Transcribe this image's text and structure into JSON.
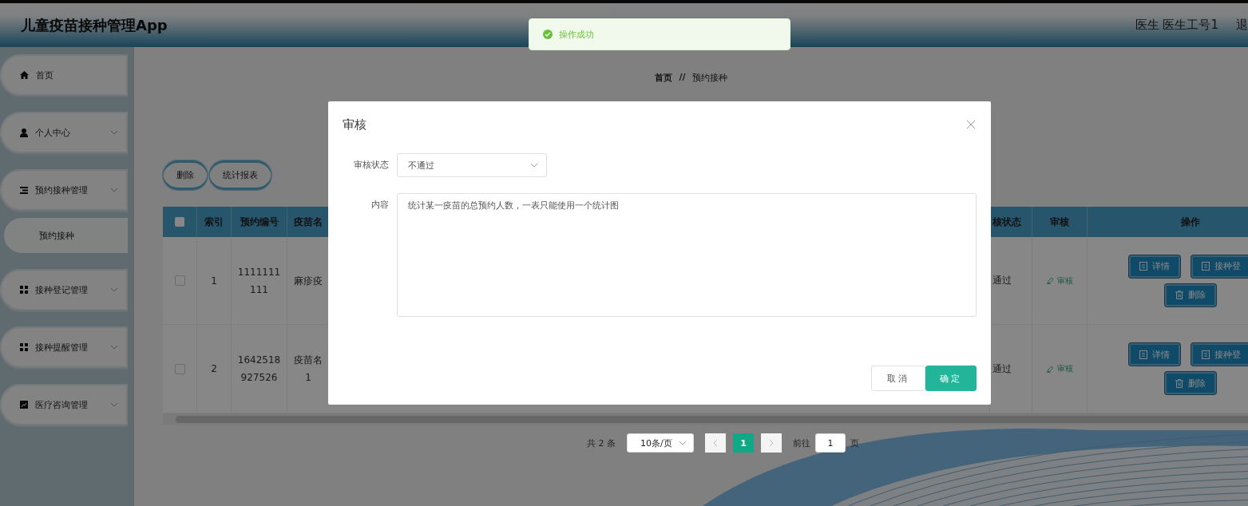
{
  "app": {
    "title": "儿童疫苗接种管理App",
    "user": "医生 医生工号1",
    "logout": "退"
  },
  "toast": {
    "kind": "success",
    "message": "操作成功"
  },
  "sidebar": {
    "items": [
      {
        "label": "首页",
        "kind": "home",
        "dropdown": false
      },
      {
        "label": "个人中心",
        "kind": "user",
        "dropdown": true
      },
      {
        "label": "预约接种管理",
        "kind": "list",
        "dropdown": true,
        "children": [
          {
            "label": "预约接种"
          }
        ]
      },
      {
        "label": "接种登记管理",
        "kind": "grid",
        "dropdown": true
      },
      {
        "label": "接种提醒管理",
        "kind": "grid",
        "dropdown": true
      },
      {
        "label": "医疗咨询管理",
        "kind": "chart",
        "dropdown": true
      }
    ]
  },
  "breadcrumb": {
    "items": [
      "首页",
      "预约接种"
    ],
    "separator": "//"
  },
  "toolbar": [
    "删除",
    "统计报表"
  ],
  "table": {
    "header_checked": false,
    "columns": [
      "索引",
      "预约编号",
      "疫苗名",
      "核状态",
      "审核",
      "操作"
    ],
    "rows": [
      {
        "checked": false,
        "index": "1",
        "number": "1111111111",
        "vaccine": [
          "麻疹疫"
        ],
        "status": "通过",
        "review": "审核",
        "actions": [
          "详情",
          "接种登",
          "删除"
        ]
      },
      {
        "checked": false,
        "index": "2",
        "number": "1642518927526",
        "vaccine": [
          "疫苗名",
          "1"
        ],
        "status": "通过",
        "review": "审核",
        "actions": [
          "详情",
          "接种登",
          "删除"
        ]
      }
    ]
  },
  "pagination": {
    "total": "共 2 条",
    "page_size": "10条/页",
    "pages": [
      {
        "label": "1",
        "selected": true
      }
    ],
    "goto_label": "前往",
    "goto_value": "1",
    "goto_suffix": "页"
  },
  "dialog": {
    "title": "审核",
    "fields": [
      {
        "label": "审核状态",
        "kind": "select",
        "value": "不通过"
      },
      {
        "label": "内容",
        "kind": "textarea",
        "value": "统计某一疫苗的总预约人数，一表只能使用一个统计图"
      }
    ],
    "buttons": [
      {
        "label": "取消",
        "kind": "default"
      },
      {
        "label": "确定",
        "kind": "primary"
      }
    ]
  }
}
